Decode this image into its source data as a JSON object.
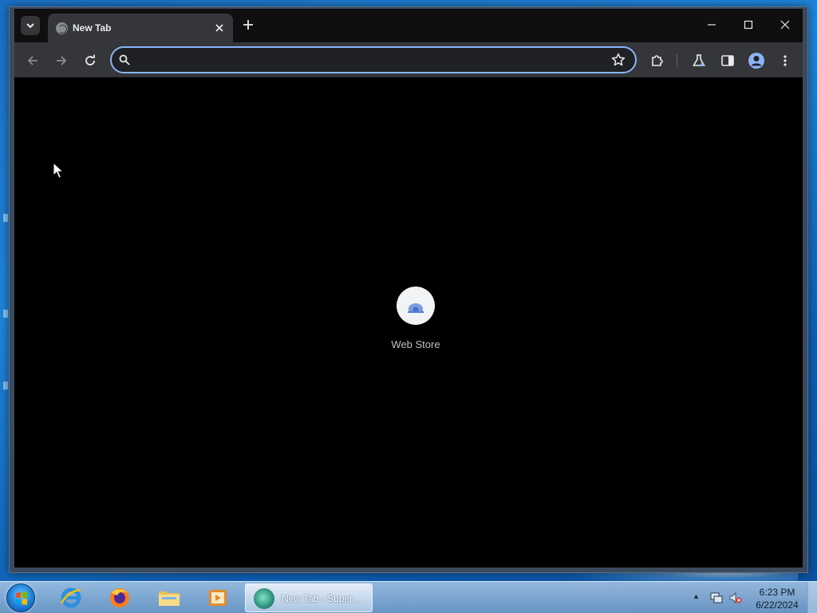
{
  "browser": {
    "tab": {
      "title": "New Tab"
    },
    "omnibox": {
      "value": "",
      "placeholder": ""
    },
    "shortcuts": [
      {
        "title": "Web Store"
      }
    ]
  },
  "taskbar": {
    "task_label": "New Tab - Super...",
    "clock": {
      "time": "6:23 PM",
      "date": "6/22/2024"
    }
  }
}
